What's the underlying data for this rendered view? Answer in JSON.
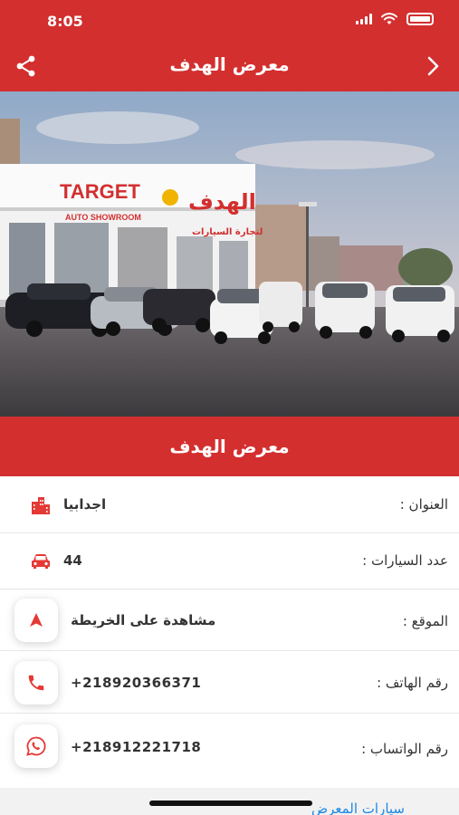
{
  "status_bar": {
    "time": "8:05"
  },
  "header": {
    "title": "معرض الهدف"
  },
  "hero": {
    "sign_target": "TARGET",
    "sign_auto": "AUTO SHOWROOM",
    "sign_arabic": "الهدف",
    "sign_arabic_sub": "لتجارة السيارات"
  },
  "showroom": {
    "name": "معرض الهدف"
  },
  "info": {
    "address": {
      "label": "العنوان :",
      "value": "اجدابيا"
    },
    "cars_count": {
      "label": "عدد السيارات :",
      "value": "44"
    },
    "location": {
      "label": "الموقع :",
      "value": "مشاهدة على الخريطة"
    },
    "phone": {
      "label": "رقم الهاتف :",
      "value": "+218920366371"
    },
    "whatsapp": {
      "label": "رقم الواتساب :",
      "value": "+218912221718"
    }
  },
  "footer": {
    "section_title": "سيارات المعرض"
  },
  "colors": {
    "primary": "#d32f2f",
    "link": "#1e88e5"
  }
}
